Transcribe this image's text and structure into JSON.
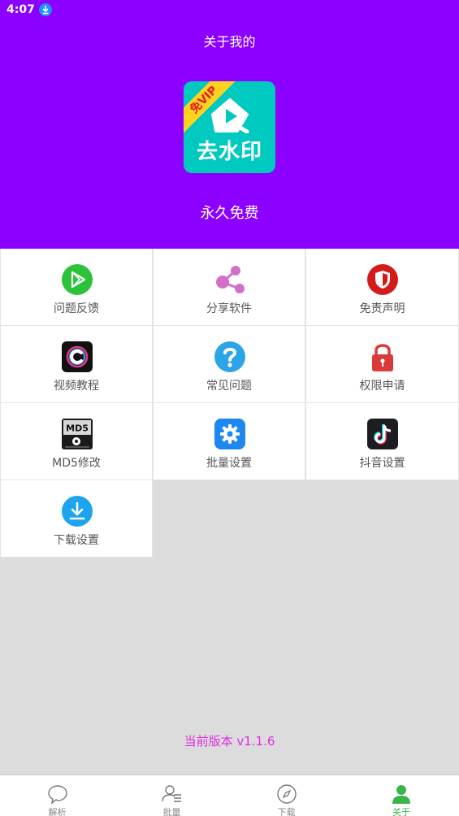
{
  "status_bar": {
    "time": "4:07"
  },
  "header": {
    "title": "关于我的",
    "logo": {
      "ribbon": "免VIP",
      "text": "去水印"
    },
    "slogan": "永久免费",
    "bg_color": "#8b00ff"
  },
  "grid": {
    "items": [
      {
        "label": "问题反馈",
        "icon": "play-store-icon"
      },
      {
        "label": "分享软件",
        "icon": "share-icon"
      },
      {
        "label": "免责声明",
        "icon": "shield-icon"
      },
      {
        "label": "视频教程",
        "icon": "video-tutorial-icon"
      },
      {
        "label": "常见问题",
        "icon": "question-icon"
      },
      {
        "label": "权限申请",
        "icon": "lock-icon"
      },
      {
        "label": "MD5修改",
        "icon": "md5-icon"
      },
      {
        "label": "批量设置",
        "icon": "settings-gear-icon"
      },
      {
        "label": "抖音设置",
        "icon": "tiktok-icon"
      },
      {
        "label": "下载设置",
        "icon": "download-icon"
      }
    ]
  },
  "version_text": "当前版本 v1.1.6",
  "tabbar": {
    "tabs": [
      {
        "label": "解析",
        "icon": "chat-bubble-icon",
        "active": false
      },
      {
        "label": "批量",
        "icon": "user-list-icon",
        "active": false
      },
      {
        "label": "下载",
        "icon": "compass-icon",
        "active": false
      },
      {
        "label": "关于",
        "icon": "person-icon",
        "active": true
      }
    ],
    "active_color": "#3bb54a"
  }
}
